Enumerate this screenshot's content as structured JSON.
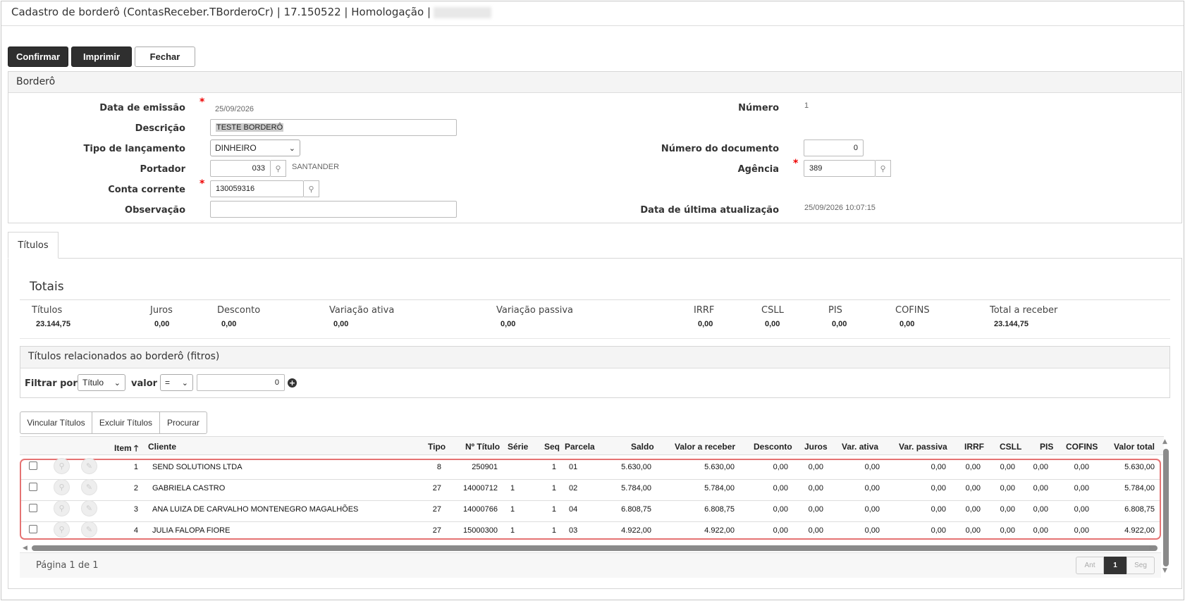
{
  "window": {
    "title": "Cadastro de borderô (ContasReceber.TBorderoCr) | 17.150522 | Homologação |"
  },
  "toolbar": {
    "confirm": "Confirmar",
    "print": "Imprimir",
    "close": "Fechar"
  },
  "bordero": {
    "section_title": "Borderô",
    "data_emissao_label": "Data de emissão",
    "data_emissao": "25/09/2026",
    "descricao_label": "Descrição",
    "descricao": "TESTE BORDERÔ",
    "tipo_label": "Tipo de lançamento",
    "tipo": "DINHEIRO",
    "portador_label": "Portador",
    "portador": "033",
    "portador_nome": "SANTANDER",
    "conta_label": "Conta corrente",
    "conta": "130059316",
    "obs_label": "Observação",
    "obs": "",
    "numero_label": "Número",
    "numero": "1",
    "num_doc_label": "Número do documento",
    "num_doc": "0",
    "agencia_label": "Agência",
    "agencia": "389",
    "ultima_label": "Data de última atualização",
    "ultima": "25/09/2026 10:07:15"
  },
  "tabs": {
    "titulos": "Títulos"
  },
  "totais": {
    "title": "Totais",
    "items": [
      {
        "label": "Títulos",
        "value": "23.144,75"
      },
      {
        "label": "Juros",
        "value": "0,00"
      },
      {
        "label": "Desconto",
        "value": "0,00"
      },
      {
        "label": "Variação ativa",
        "value": "0,00"
      },
      {
        "label": "Variação passiva",
        "value": "0,00"
      },
      {
        "label": "IRRF",
        "value": "0,00"
      },
      {
        "label": "CSLL",
        "value": "0,00"
      },
      {
        "label": "PIS",
        "value": "0,00"
      },
      {
        "label": "COFINS",
        "value": "0,00"
      },
      {
        "label": "Total a receber",
        "value": "23.144,75"
      }
    ]
  },
  "filter": {
    "title": "Títulos relacionados ao borderô (fitros)",
    "filtrar_label": "Filtrar por",
    "field": "Título",
    "valor_label": "valor",
    "operator": "=",
    "value": "0"
  },
  "actions": {
    "vincular": "Vincular Títulos",
    "excluir": "Excluir Títulos",
    "procurar": "Procurar"
  },
  "table": {
    "columns": [
      "Item",
      "Cliente",
      "Tipo",
      "Nº Título",
      "Série",
      "Seq",
      "Parcela",
      "Saldo",
      "Valor a receber",
      "Desconto",
      "Juros",
      "Var. ativa",
      "Var. passiva",
      "IRRF",
      "CSLL",
      "PIS",
      "COFINS",
      "Valor total"
    ],
    "rows": [
      [
        "1",
        "SEND SOLUTIONS LTDA",
        "8",
        "250901",
        "",
        "1",
        "01",
        "5.630,00",
        "5.630,00",
        "0,00",
        "0,00",
        "0,00",
        "0,00",
        "0,00",
        "0,00",
        "0,00",
        "0,00",
        "5.630,00"
      ],
      [
        "2",
        "GABRIELA CASTRO",
        "27",
        "14000712",
        "1",
        "1",
        "02",
        "5.784,00",
        "5.784,00",
        "0,00",
        "0,00",
        "0,00",
        "0,00",
        "0,00",
        "0,00",
        "0,00",
        "0,00",
        "5.784,00"
      ],
      [
        "3",
        "ANA LUIZA DE CARVALHO MONTENEGRO MAGALHÕES",
        "27",
        "14000766",
        "1",
        "1",
        "04",
        "6.808,75",
        "6.808,75",
        "0,00",
        "0,00",
        "0,00",
        "0,00",
        "0,00",
        "0,00",
        "0,00",
        "0,00",
        "6.808,75"
      ],
      [
        "4",
        "JULIA FALOPA FIORE",
        "27",
        "15000300",
        "1",
        "1",
        "03",
        "4.922,00",
        "4.922,00",
        "0,00",
        "0,00",
        "0,00",
        "0,00",
        "0,00",
        "0,00",
        "0,00",
        "0,00",
        "4.922,00"
      ]
    ]
  },
  "pagination": {
    "info": "Página 1 de 1",
    "prev": "Ant",
    "current": "1",
    "next": "Seg"
  },
  "colors": {
    "dark_button": "#2f2f2f",
    "highlight": "#e57373",
    "required": "#ee0000"
  }
}
